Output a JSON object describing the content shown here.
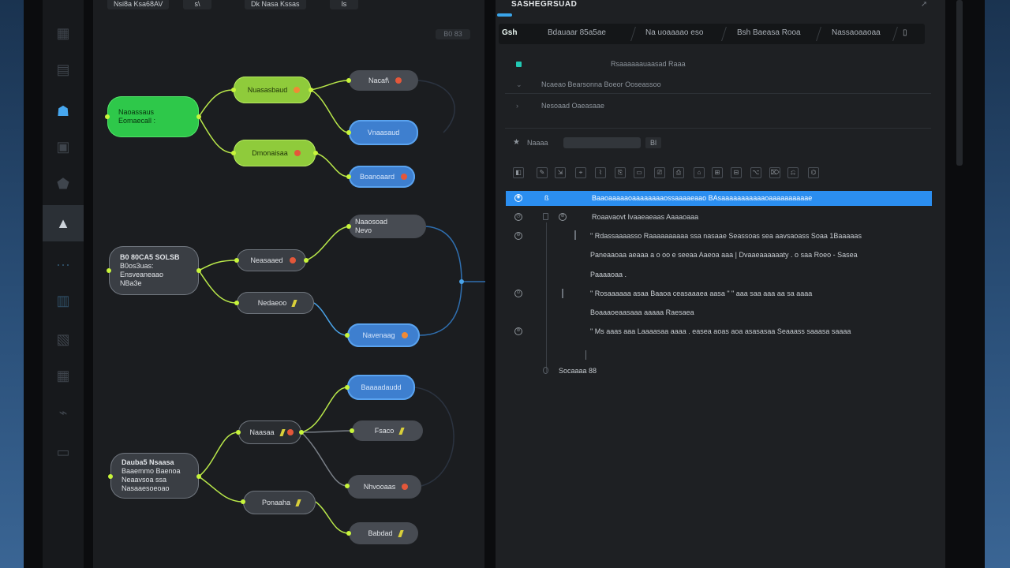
{
  "app": {
    "top_chips": [
      "Nsi8a Ksa68AV",
      "s\\",
      "Dk Nasa Kssas",
      "ls"
    ],
    "zoom_label": "B0 83"
  },
  "sidebar": {
    "items": [
      {
        "icon": "grid-icon",
        "glyph": "▦"
      },
      {
        "icon": "book-icon",
        "glyph": "▤"
      },
      {
        "icon": "users-icon",
        "glyph": "☗"
      },
      {
        "icon": "calendar-icon",
        "glyph": "▣"
      },
      {
        "icon": "shield-icon",
        "glyph": "⬟"
      },
      {
        "icon": "inbox-icon",
        "glyph": "▲"
      },
      {
        "icon": "link-icon",
        "glyph": "⋯"
      },
      {
        "icon": "chart-icon",
        "glyph": "▥"
      },
      {
        "icon": "layers-icon",
        "glyph": "▧"
      },
      {
        "icon": "calendar-icon",
        "glyph": "▦"
      },
      {
        "icon": "activity-icon",
        "glyph": "⌁"
      },
      {
        "icon": "archive-icon",
        "glyph": "▭"
      }
    ]
  },
  "mindmap": {
    "nodes": {
      "root1": [
        "Naoassaus",
        "Eomaecall :"
      ],
      "n_a": "Nuasasbaud",
      "n_b": "Dmonaisaa",
      "n_c": "Nacaf\\",
      "n_d": "Vnaasaud",
      "n_e": "Boanoaard",
      "root2": [
        "B0 80CA5 SOLSB",
        "B0os3uas:",
        "Ensveaneaao",
        "NBa3e"
      ],
      "n_f": "Neasaaed",
      "n_g": "Nedaeoo",
      "n_h": "Naaosoad",
      "n_h2": "Nevo",
      "n_i": "Navenaag",
      "root3": [
        "Dauba5 Nsaasa",
        "Baaemmo Baenoa",
        "Neaavsoa ssa",
        "Nasaaesoeoao"
      ],
      "n_j": "Naasaa",
      "n_k": "Ponaaha",
      "n_l": "Baaaadaudd",
      "n_m": "Fsaco",
      "n_n": "Nhvooaas",
      "n_o": "Babdad"
    }
  },
  "right": {
    "title": "SASHEGRSUAD",
    "tabs": [
      "Gsh",
      "Bdauaar 85a5ae",
      "Na uoaaaao eso",
      "Bsh Baeasa Rooa",
      "Nassaoaaoaa"
    ],
    "meta": [
      "Rsaaaaaauaasad Raaa",
      "Ncaeao Bearsonna Boeor Ooseassoo",
      "Nesoaad Oaeasaae"
    ],
    "search": {
      "label": "Naaaa",
      "value": "",
      "count": "Bl"
    },
    "toolbar": [
      "◧",
      "✎",
      "⇲",
      "⌖",
      "⌇",
      "⎘",
      "▭",
      "⎚",
      "⎙",
      "⌂",
      "⊞",
      "⊟",
      "⌥",
      "⌦",
      "⎌",
      "⌬"
    ],
    "rows": [
      {
        "id": "ra",
        "text": "Baaoaaaaaoaaaaaaaaossaaaaeaao BAsaaaaaaaaaaaoaaaaaaaaaae"
      },
      {
        "id": "rb",
        "text": "Roaavaovt Ivaaeaeaas Aaaaoaaa"
      },
      {
        "id": "rc",
        "text": "\" Rdassaaaasso Raaaaaaaaaa ssa nasaae Seassoas sea aavsaoass Soaa 1Baaaaas"
      },
      {
        "id": "rd",
        "text": "Paneaaoaa aeaaa a o oo e seeaa Aaeoa aaa | Dvaaeaaaaaaty . o saa Roeo - Sasea"
      },
      {
        "id": "re",
        "text": "Paaaaoaa ."
      },
      {
        "id": "rf",
        "text": "\" Rosaaaaaa asaa Baaoa ceasaaaea aasa \" \" aaa saa aaa aa sa aaaa"
      },
      {
        "id": "rg",
        "text": "Boaaaoeaasaaa aaaaa Raesaea"
      },
      {
        "id": "rh",
        "text": "\" Ms aaas aaa Laaaasaa aaaa . easea aoas aoa asasasaa Seaaass saaasa saaaa"
      },
      {
        "id": "ri",
        "text": "Socaaaa 88"
      }
    ]
  },
  "colors": {
    "accent": "#2b8ef0",
    "green": "#2ec84a",
    "lime": "#8fcb3b",
    "blue": "#3e7fcf",
    "gray": "#474b52"
  }
}
